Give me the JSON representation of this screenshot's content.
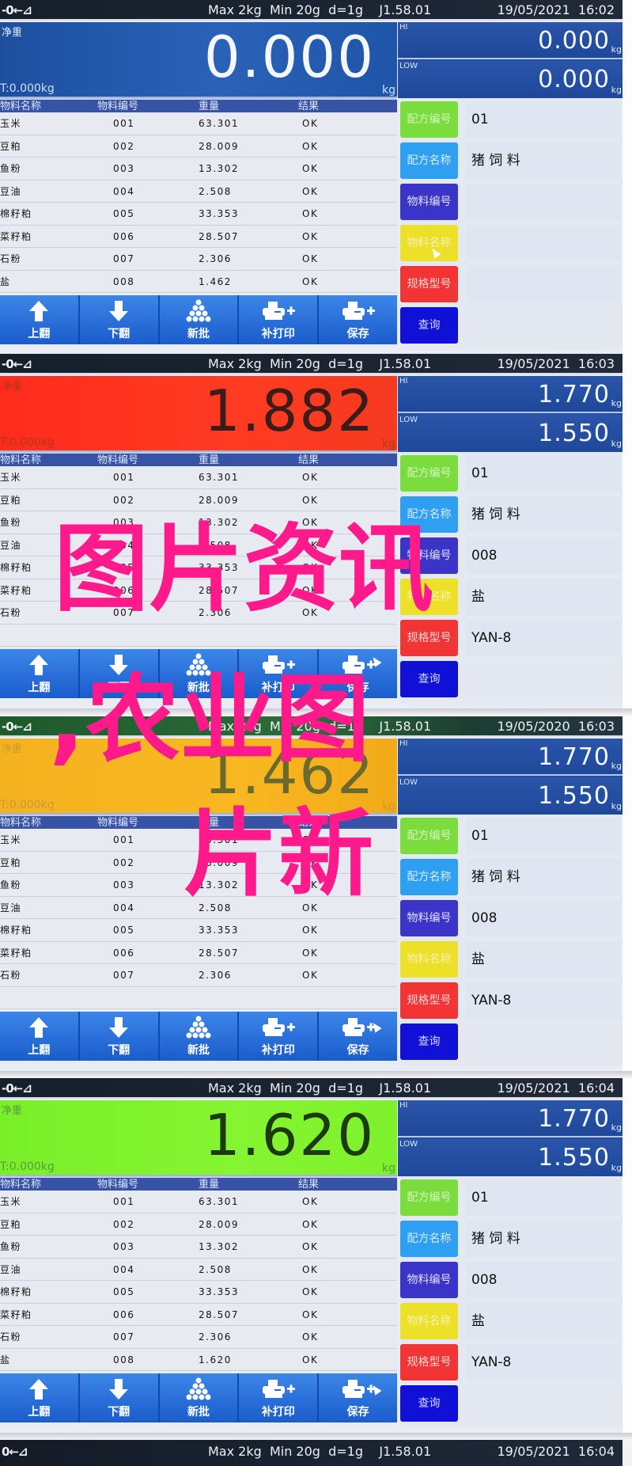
{
  "common": {
    "status_left": "-0←⊿",
    "spec": "Max 2kg  Min 20g  d=1g    J1.58.01",
    "net_label": "净重",
    "tare": "T:0.000kg",
    "unit": "kg",
    "hi_label": "HI",
    "low_label": "LOW",
    "table_headers": [
      "物料名称",
      "物料编号",
      "重量",
      "结果"
    ],
    "toolbar": [
      "上翻",
      "下翻",
      "新批",
      "补打印",
      "保存"
    ],
    "side_buttons": [
      "配方编号",
      "配方名称",
      "物料编号",
      "物料名称",
      "规格型号",
      "查询"
    ]
  },
  "panels": [
    {
      "datetime": "19/05/2021  16:02",
      "weight": "0.000",
      "hi": "0.000",
      "low": "0.000",
      "rows": [
        [
          "玉米",
          "001",
          "63.301",
          "OK"
        ],
        [
          "豆粕",
          "002",
          "28.009",
          "OK"
        ],
        [
          "鱼粉",
          "003",
          "13.302",
          "OK"
        ],
        [
          "豆油",
          "004",
          "2.508",
          "OK"
        ],
        [
          "棉籽粕",
          "005",
          "33.353",
          "OK"
        ],
        [
          "菜籽粕",
          "006",
          "28.507",
          "OK"
        ],
        [
          "石粉",
          "007",
          "2.306",
          "OK"
        ],
        [
          "盐",
          "008",
          "1.462",
          "OK"
        ]
      ],
      "side_values": [
        "01",
        "猪 饲 料",
        "",
        "",
        ""
      ]
    },
    {
      "datetime": "19/05/2021  16:03",
      "weight": "1.882",
      "hi": "1.770",
      "low": "1.550",
      "rows": [
        [
          "玉米",
          "001",
          "63.301",
          "OK"
        ],
        [
          "豆粕",
          "002",
          "28.009",
          "OK"
        ],
        [
          "鱼粉",
          "003",
          "13.302",
          "OK"
        ],
        [
          "豆油",
          "004",
          "2.508",
          "OK"
        ],
        [
          "棉籽粕",
          "005",
          "33.353",
          "OK"
        ],
        [
          "菜籽粕",
          "006",
          "28.507",
          "OK"
        ],
        [
          "石粉",
          "007",
          "2.306",
          "OK"
        ],
        [
          "",
          "",
          "",
          ""
        ]
      ],
      "side_values": [
        "01",
        "猪 饲 料",
        "008",
        "盐",
        "YAN-8"
      ]
    },
    {
      "datetime": "19/05/2020  16:03",
      "weight": "1.462",
      "hi": "1.770",
      "low": "1.550",
      "rows": [
        [
          "玉米",
          "001",
          "63.301",
          "OK"
        ],
        [
          "豆粕",
          "002",
          "28.009",
          "OK"
        ],
        [
          "鱼粉",
          "003",
          "13.302",
          "OK"
        ],
        [
          "豆油",
          "004",
          "2.508",
          "OK"
        ],
        [
          "棉籽粕",
          "005",
          "33.353",
          "OK"
        ],
        [
          "菜籽粕",
          "006",
          "28.507",
          "OK"
        ],
        [
          "石粉",
          "007",
          "2.306",
          "OK"
        ],
        [
          "",
          "",
          "",
          ""
        ]
      ],
      "side_values": [
        "01",
        "猪 饲 料",
        "008",
        "盐",
        "YAN-8"
      ]
    },
    {
      "datetime": "19/05/2021  16:04",
      "weight": "1.620",
      "hi": "1.770",
      "low": "1.550",
      "rows": [
        [
          "玉米",
          "001",
          "63.301",
          "OK"
        ],
        [
          "豆粕",
          "002",
          "28.009",
          "OK"
        ],
        [
          "鱼粉",
          "003",
          "13.302",
          "OK"
        ],
        [
          "豆油",
          "004",
          "2.508",
          "OK"
        ],
        [
          "棉籽粕",
          "005",
          "33.353",
          "OK"
        ],
        [
          "菜籽粕",
          "006",
          "28.507",
          "OK"
        ],
        [
          "石粉",
          "007",
          "2.306",
          "OK"
        ],
        [
          "盐",
          "008",
          "1.620",
          "OK"
        ]
      ],
      "side_values": [
        "01",
        "猪 饲 料",
        "008",
        "盐",
        "YAN-8"
      ]
    }
  ],
  "final_bar": {
    "status_left": "0←⊿",
    "spec": "Max 2kg  Min 20g  d=1g    J1.58.01",
    "datetime": "19/05/2021  16:04"
  },
  "watermark": {
    "line1": "图片资讯",
    "line2": ",农业图",
    "line3": "片新"
  },
  "colors": {
    "watermark": "#ff1a8c",
    "readout_states": [
      "blue",
      "red",
      "amber",
      "lime"
    ]
  }
}
